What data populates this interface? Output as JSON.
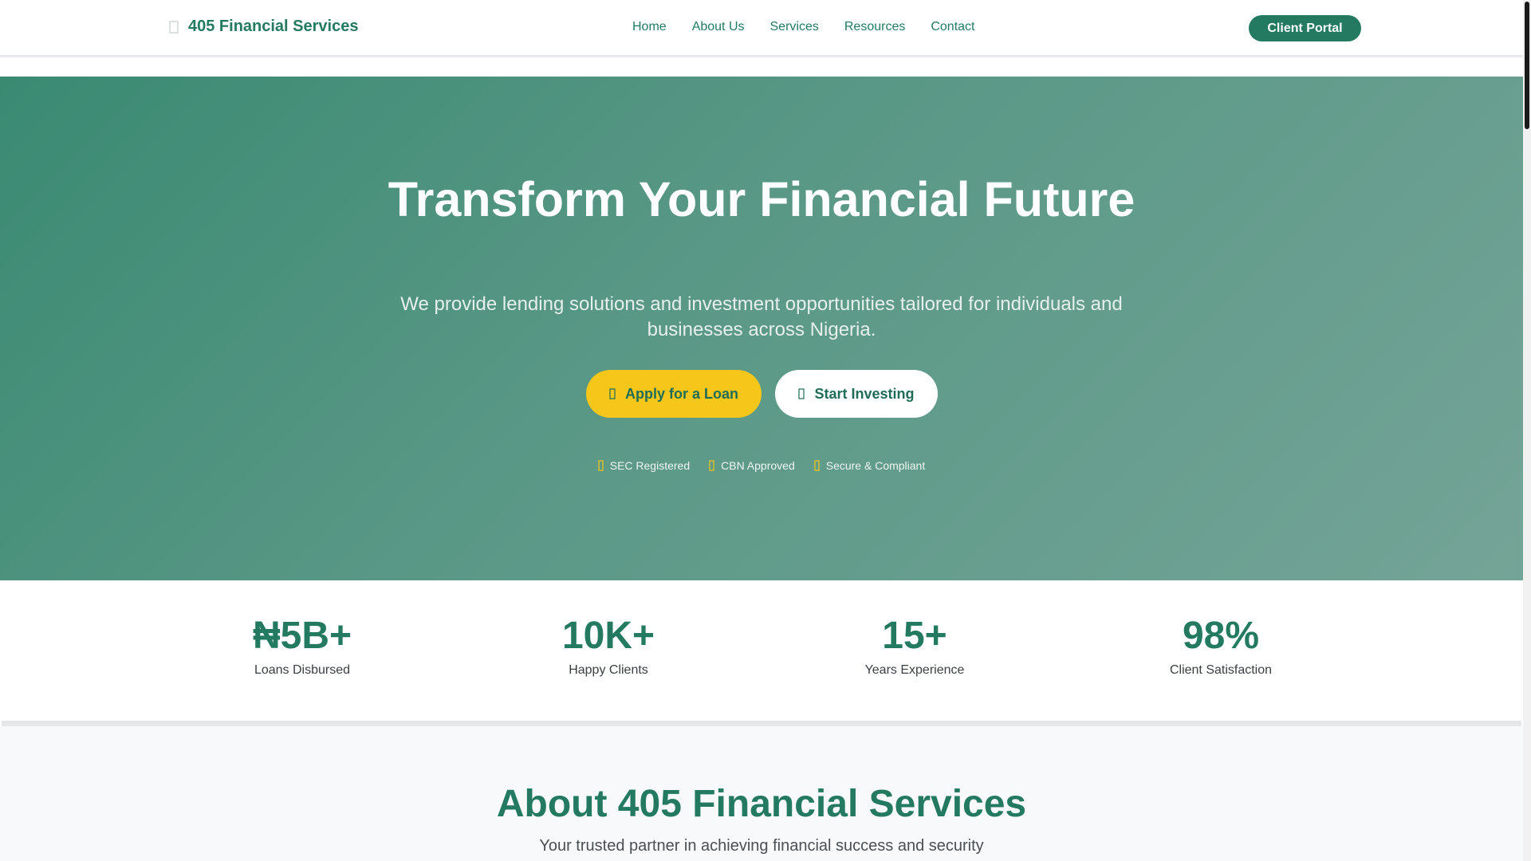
{
  "nav": {
    "brand": "405 Financial Services",
    "brand_icon": "building-icon",
    "links": [
      "Home",
      "About Us",
      "Services",
      "Resources",
      "Contact"
    ],
    "portal_button": "Client Portal"
  },
  "hero": {
    "title": "Transform Your Financial Future",
    "subtitle": "We provide lending solutions and investment opportunities tailored for individuals and businesses across Nigeria.",
    "buttons": [
      {
        "label": "Apply for a Loan",
        "icon": "hand-money-icon"
      },
      {
        "label": "Start Investing",
        "icon": "chart-line-icon"
      }
    ],
    "badges": [
      {
        "label": "SEC Registered",
        "icon": "shield-check-icon"
      },
      {
        "label": "CBN Approved",
        "icon": "bank-icon"
      },
      {
        "label": "Secure & Compliant",
        "icon": "lock-icon"
      }
    ]
  },
  "stats": [
    {
      "value": "₦5B+",
      "label": "Loans Disbursed"
    },
    {
      "value": "10K+",
      "label": "Happy Clients"
    },
    {
      "value": "15+",
      "label": "Years Experience"
    },
    {
      "value": "98%",
      "label": "Client Satisfaction"
    }
  ],
  "about": {
    "title": "About 405 Financial Services",
    "subtitle": "Your trusted partner in achieving financial success and security"
  },
  "colors": {
    "brand_green": "#237a60",
    "accent_yellow": "#f6c61b"
  }
}
